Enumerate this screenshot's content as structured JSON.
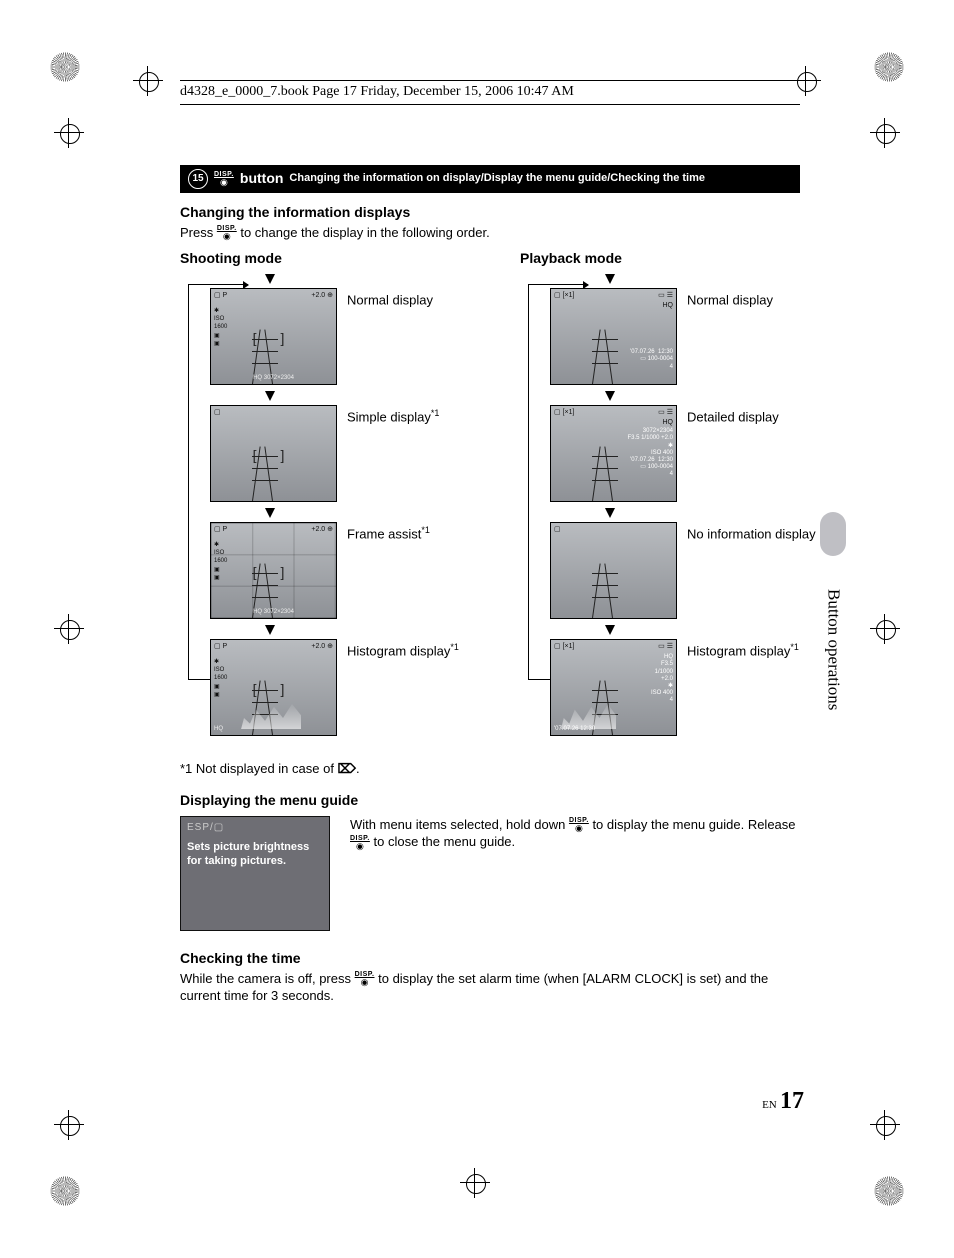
{
  "header": {
    "book_line": "d4328_e_0000_7.book  Page 17  Friday, December 15, 2006  10:47 AM"
  },
  "section_bar": {
    "number": "⓯",
    "button_word": "button",
    "desc": "Changing the information on display/Display the menu guide/Checking the time"
  },
  "h_changing": "Changing the information displays",
  "p_press_prefix": "Press ",
  "p_press_suffix": " to change the display in the following order.",
  "shooting": {
    "title": "Shooting mode",
    "steps": [
      {
        "label": "Normal display",
        "sup": ""
      },
      {
        "label": "Simple display",
        "sup": "*1"
      },
      {
        "label": "Frame assist",
        "sup": "*1"
      },
      {
        "label": "Histogram display",
        "sup": "*1"
      }
    ],
    "lcd_full": {
      "top_left": "▢ P",
      "top_right": "+2.0  ⊕",
      "left": "✱\nISO\n1600\n▣\n▣",
      "bottom": "HQ 3072×2304",
      "focus": "[  ]"
    },
    "lcd_simple": {
      "top_left": "▢",
      "focus": "[  ]"
    },
    "lcd_frame": {
      "top_left": "▢ P",
      "top_right": "+2.0  ⊕",
      "left": "✱\nISO\n1600\n▣\n▣",
      "bottom": "HQ 3072×2304",
      "focus": "[  ]"
    },
    "lcd_hist": {
      "top_left": "▢ P",
      "top_right": "+2.0  ⊕",
      "left": "✱\nISO\n1600\n▣\n▣",
      "bottom": "HQ",
      "focus": "[  ]"
    }
  },
  "playback": {
    "title": "Playback mode",
    "steps": [
      {
        "label": "Normal display",
        "sup": ""
      },
      {
        "label": "Detailed display",
        "sup": ""
      },
      {
        "label": "No information display",
        "sup": ""
      },
      {
        "label": "Histogram display",
        "sup": "*1"
      }
    ],
    "lcd_normal": {
      "top_left": "▢  [×1]",
      "top_right": "▭ ☰\nHQ",
      "right": "'07.07.26  12:30\n▭ 100-0004\n4"
    },
    "lcd_detail": {
      "top_left": "▢  [×1]",
      "top_right": "▭ ☰\nHQ",
      "right": "3072×2304\nF3.5 1/1000 +2.0\n✱\nISO 400\n'07.07.26  12:30\n▭ 100-0004\n4"
    },
    "lcd_none": {
      "top_left": "▢"
    },
    "lcd_hist": {
      "top_left": "▢  [×1]",
      "top_right": "▭ ☰",
      "right": "HQ\nF3.5\n1/1000\n+2.0\n✱\nISO 400\n4",
      "bottom": "'07.07.26  12:30"
    }
  },
  "footnote": "*1 Not displayed in case of ",
  "footnote_icon": "🎬",
  "footnote_end": ".",
  "h_menu": "Displaying the menu guide",
  "menu_box": {
    "top": "ESP/▢",
    "line": "Sets picture brightness for taking pictures."
  },
  "menu_text_1a": "With menu items selected, hold down ",
  "menu_text_1b": " to display the menu guide. Release ",
  "menu_text_1c": " to close the menu guide.",
  "h_time": "Checking the time",
  "time_text_a": "While the camera is off, press ",
  "time_text_b": " to display the set alarm time (when [ALARM CLOCK] is set) and the current time for 3 seconds.",
  "side_tab": "Button operations",
  "page": {
    "en": "EN",
    "num": "17"
  }
}
